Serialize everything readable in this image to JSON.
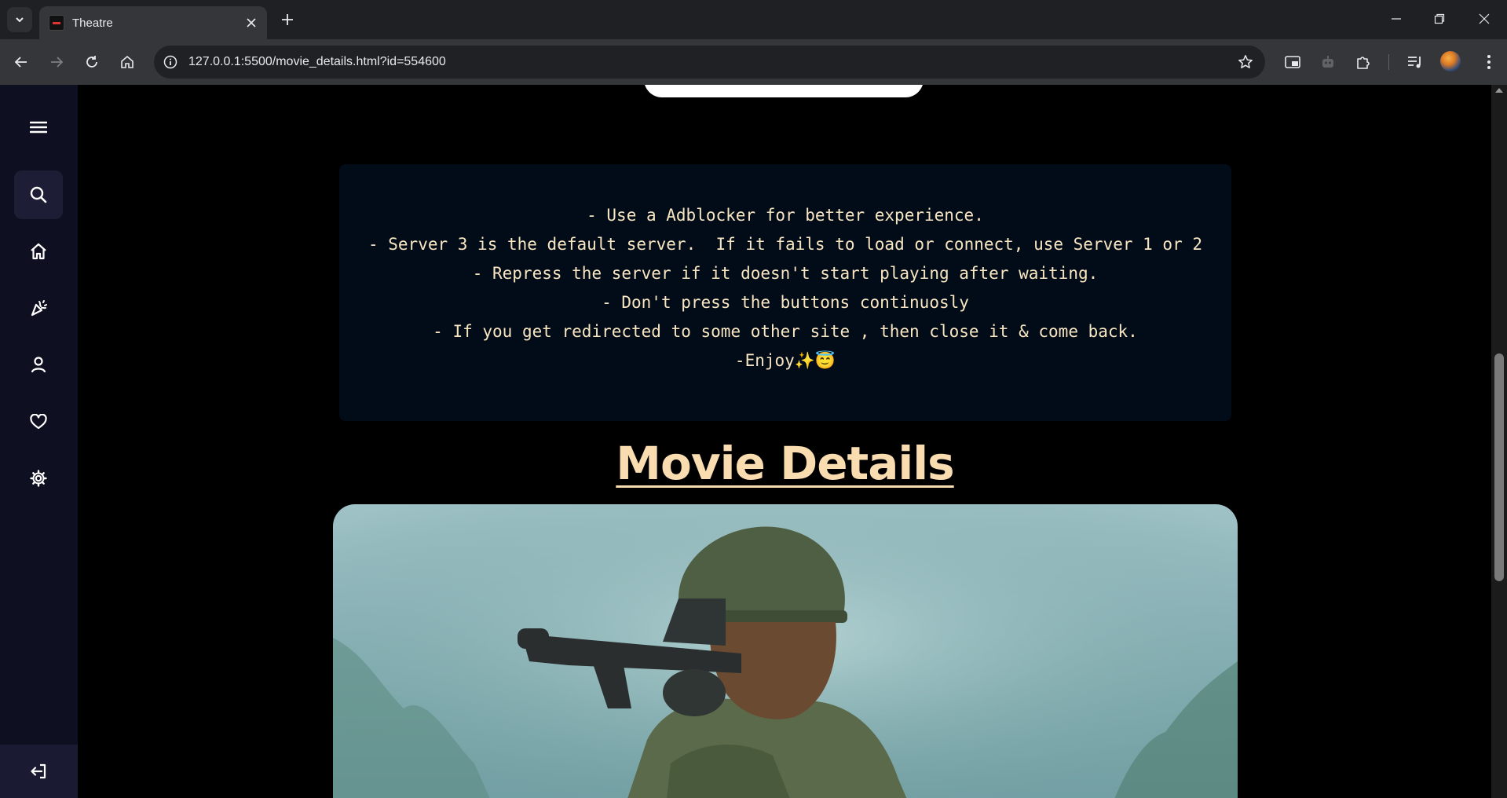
{
  "browser": {
    "tab_title": "Theatre",
    "url": "127.0.0.1:5500/movie_details.html?id=554600"
  },
  "icons": {
    "tab_search": "chevron-down-icon",
    "close_tab": "close-icon",
    "new_tab": "plus-icon",
    "minimize": "minimize-icon",
    "restore": "restore-icon",
    "close_window": "close-icon",
    "back": "arrow-left-icon",
    "forward": "arrow-right-icon",
    "reload": "reload-icon",
    "home": "home-icon",
    "site_info": "info-icon",
    "bookmark": "star-icon",
    "extensions": "puzzle-icon",
    "sidebar_menu": "hamburger-icon",
    "sidebar_search": "search-icon",
    "sidebar_home": "home-icon",
    "sidebar_genres": "party-popper-icon",
    "sidebar_profile": "user-icon",
    "sidebar_favorites": "heart-icon",
    "sidebar_settings": "gear-icon",
    "sidebar_logout": "logout-icon"
  },
  "notice": {
    "lines": [
      "- Use a Adblocker for better experience.",
      "- Server 3 is the default server.  If it fails to load or connect, use Server 1 or 2",
      "- Repress the server if it doesn't start playing after waiting.",
      "- Don't press the buttons continuosly",
      "- If you get redirected to some other site , then close it & come back.",
      "-Enjoy✨😇"
    ]
  },
  "section_title": "Movie Details",
  "colors": {
    "accent_text": "#f9dcb0",
    "notice_text": "#f8e6c2",
    "notice_bg": "#020c18",
    "sidebar_bg": "#0f0f22"
  }
}
